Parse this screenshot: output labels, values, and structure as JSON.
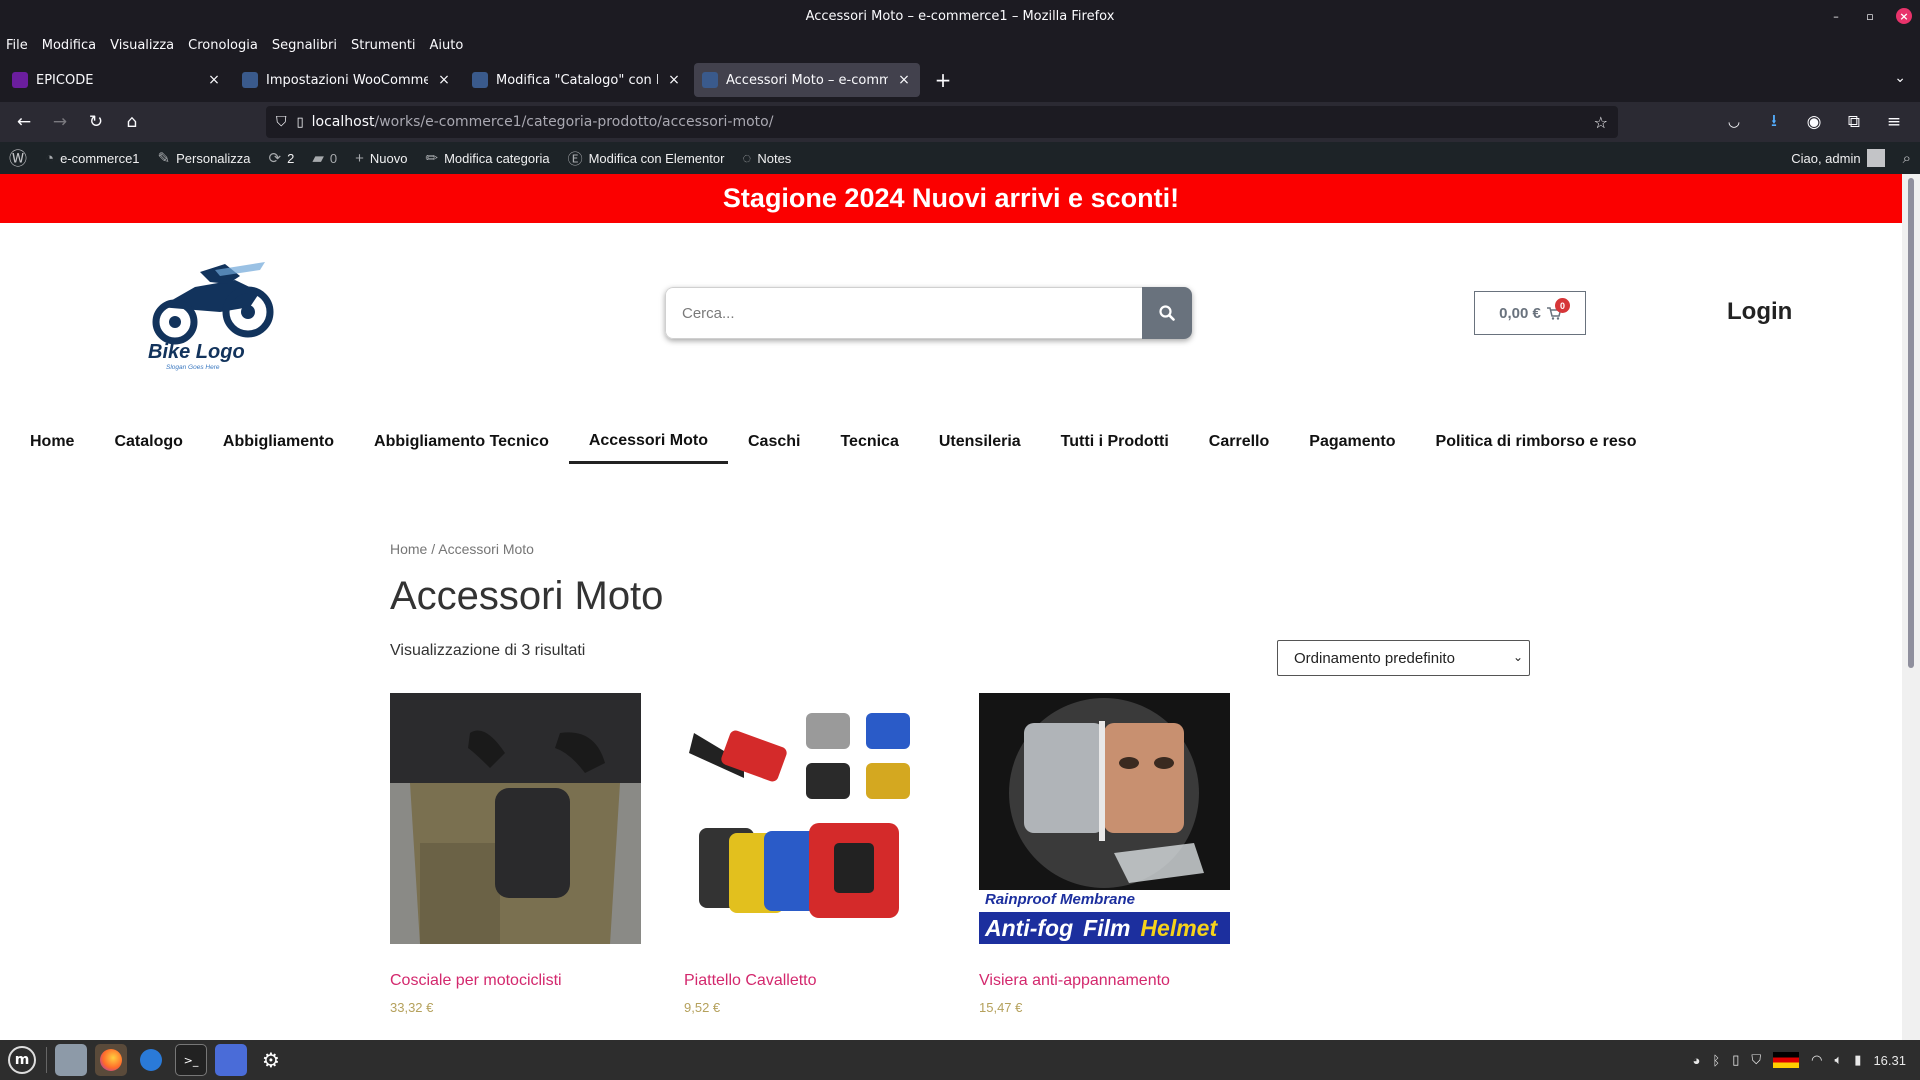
{
  "window": {
    "title": "Accessori Moto – e-commerce1 – Mozilla Firefox"
  },
  "menu": [
    "File",
    "Modifica",
    "Visualizza",
    "Cronologia",
    "Segnalibri",
    "Strumenti",
    "Aiuto"
  ],
  "tabs": [
    {
      "label": "EPICODE",
      "fav_color": "#6b1e9e"
    },
    {
      "label": "Impostazioni WooCommerce",
      "fav_color": "#3a5a8c"
    },
    {
      "label": "Modifica \"Catalogo\" con Ele",
      "fav_color": "#3a5a8c"
    },
    {
      "label": "Accessori Moto – e-commerce",
      "fav_color": "#3a5a8c"
    }
  ],
  "url": {
    "host": "localhost",
    "path": "/works/e-commerce1/categoria-prodotto/accessori-moto/"
  },
  "wpbar": {
    "site": "e-commerce1",
    "customize": "Personalizza",
    "updates": "2",
    "comments": "0",
    "new": "Nuovo",
    "edit_category": "Modifica categoria",
    "elementor": "Modifica con Elementor",
    "notes": "Notes",
    "greeting": "Ciao, admin"
  },
  "promo": "Stagione 2024 Nuovi arrivi e sconti!",
  "logo": {
    "title": "Bike Logo",
    "slogan": "Slogan Goes Here"
  },
  "search": {
    "placeholder": "Cerca..."
  },
  "cart": {
    "total": "0,00 €",
    "count": "0"
  },
  "login": "Login",
  "nav": [
    "Home",
    "Catalogo",
    "Abbigliamento",
    "Abbigliamento Tecnico",
    "Accessori Moto",
    "Caschi",
    "Tecnica",
    "Utensileria",
    "Tutti i Prodotti",
    "Carrello",
    "Pagamento",
    "Politica di rimborso e reso"
  ],
  "nav_active": "Accessori Moto",
  "breadcrumb": "Home / Accessori Moto",
  "page_title": "Accessori Moto",
  "result_count": "Visualizzazione di 3 risultati",
  "orderby": "Ordinamento predefinito",
  "products": [
    {
      "name": "Cosciale per motociclisti",
      "price": "33,32 €"
    },
    {
      "name": "Piattello Cavalletto",
      "price": "9,52 €"
    },
    {
      "name": "Visiera anti-appannamento",
      "price": "15,47 €",
      "banner_top": "Rainproof Membrane",
      "banner_a": "Anti-fog",
      "banner_b": "Film",
      "banner_c": "Helmet"
    }
  ],
  "taskbar": {
    "clock": "16.31"
  },
  "colors": {
    "promo": "#fb0000",
    "link": "#d3286d",
    "price": "#b5a15c"
  }
}
